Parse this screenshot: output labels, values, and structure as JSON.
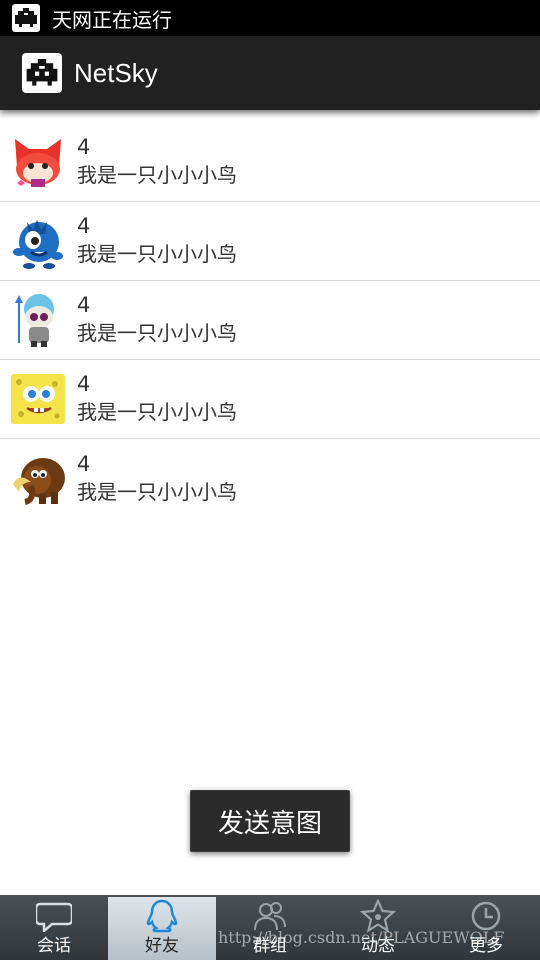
{
  "status_bar": {
    "text": "天网正在运行",
    "icon": "netsky-small-icon"
  },
  "action_bar": {
    "title": "NetSky",
    "icon": "netsky-logo-icon"
  },
  "friends": [
    {
      "name": "4",
      "signature": "我是一只小小小鸟",
      "avatar": "red-fox-avatar"
    },
    {
      "name": "4",
      "signature": "我是一只小小小鸟",
      "avatar": "blue-monster-avatar"
    },
    {
      "name": "4",
      "signature": "我是一只小小小鸟",
      "avatar": "skull-warrior-avatar"
    },
    {
      "name": "4",
      "signature": "我是一只小小小鸟",
      "avatar": "sponge-avatar"
    },
    {
      "name": "4",
      "signature": "我是一只小小小鸟",
      "avatar": "mammoth-avatar"
    }
  ],
  "toast": {
    "text": "发送意图"
  },
  "tabs": [
    {
      "label": "会话",
      "icon": "chat-bubble-icon",
      "active": false
    },
    {
      "label": "好友",
      "icon": "qq-penguin-icon",
      "active": true
    },
    {
      "label": "群组",
      "icon": "group-people-icon",
      "active": false
    },
    {
      "label": "动态",
      "icon": "star-icon",
      "active": false
    },
    {
      "label": "更多",
      "icon": "clock-icon",
      "active": false
    }
  ],
  "watermark": "http://blog.csdn.net/PLAGUEWOLF",
  "colors": {
    "status_bar": "#000000",
    "action_bar": "#212121",
    "tab_bar": "#3c4347",
    "tab_active": "#c9d1d8"
  }
}
